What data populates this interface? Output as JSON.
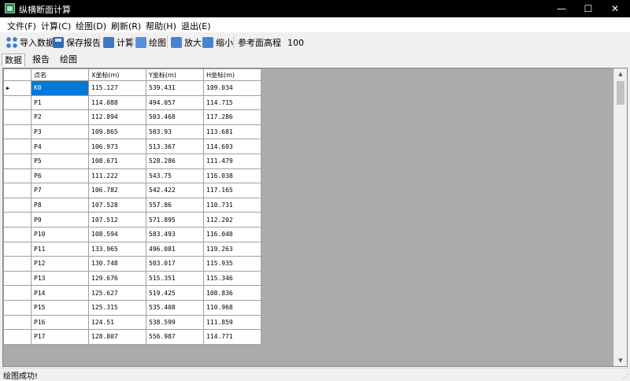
{
  "window": {
    "title": "纵横断面计算",
    "min": "—",
    "max": "☐",
    "close": "✕"
  },
  "menu": [
    {
      "label": "文件(F)"
    },
    {
      "label": "计算(C)"
    },
    {
      "label": "绘图(D)"
    },
    {
      "label": "刷新(R)"
    },
    {
      "label": "帮助(H)"
    },
    {
      "label": "退出(E)"
    }
  ],
  "toolbar": {
    "import_label": "导入数据",
    "save_label": "保存报告",
    "calc_label": "计算",
    "draw_label": "绘图",
    "zoomin_label": "放大",
    "zoomout_label": "缩小",
    "ref_label": "参考面高程",
    "ref_value": "100"
  },
  "tabs": [
    {
      "label": "数据"
    },
    {
      "label": "报告"
    },
    {
      "label": "绘图"
    }
  ],
  "grid": {
    "columns": [
      "点名",
      "X坐标(m)",
      "Y坐标(m)",
      "H坐标(m)"
    ],
    "rows": [
      [
        "K0",
        "115.127",
        "539.431",
        "109.034"
      ],
      [
        "P1",
        "114.088",
        "494.057",
        "114.715"
      ],
      [
        "P2",
        "112.894",
        "503.468",
        "117.286"
      ],
      [
        "P3",
        "109.865",
        "503.93",
        "113.681"
      ],
      [
        "P4",
        "106.973",
        "513.367",
        "114.693"
      ],
      [
        "P5",
        "108.671",
        "528.286",
        "111.479"
      ],
      [
        "P6",
        "111.222",
        "543.75",
        "116.038"
      ],
      [
        "P7",
        "106.782",
        "542.422",
        "117.165"
      ],
      [
        "P8",
        "107.528",
        "557.86",
        "110.731"
      ],
      [
        "P9",
        "107.512",
        "571.895",
        "112.202"
      ],
      [
        "P10",
        "108.594",
        "583.493",
        "116.048"
      ],
      [
        "P11",
        "133.965",
        "496.081",
        "119.263"
      ],
      [
        "P12",
        "130.748",
        "503.017",
        "115.935"
      ],
      [
        "P13",
        "129.676",
        "515.351",
        "115.346"
      ],
      [
        "P14",
        "125.627",
        "519.425",
        "108.836"
      ],
      [
        "P15",
        "125.315",
        "535.408",
        "110.968"
      ],
      [
        "P16",
        "124.51",
        "538.599",
        "111.859"
      ],
      [
        "P17",
        "128.807",
        "556.987",
        "114.771"
      ]
    ]
  },
  "status": {
    "text": "绘图成功!"
  }
}
